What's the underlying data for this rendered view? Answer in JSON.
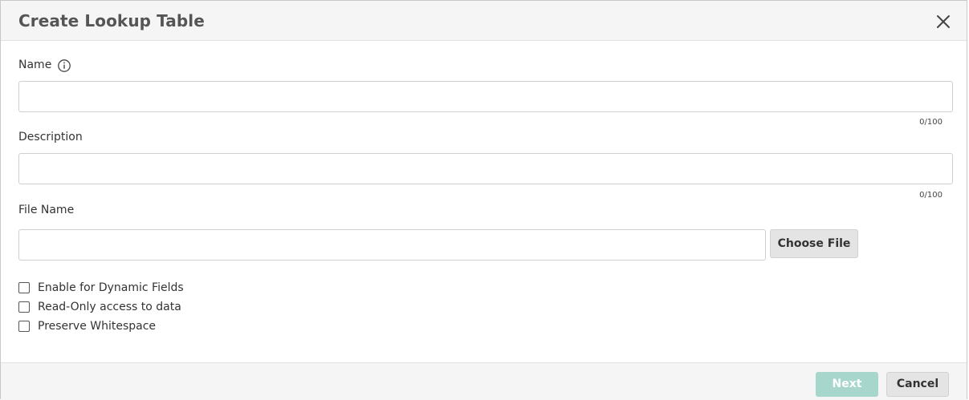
{
  "dialog": {
    "title": "Create Lookup Table",
    "close_icon": "close-icon"
  },
  "form": {
    "name": {
      "label": "Name",
      "info_icon": "info-icon",
      "value": "",
      "counter": "0/100"
    },
    "description": {
      "label": "Description",
      "value": "",
      "counter": "0/100"
    },
    "file_name": {
      "label": "File Name",
      "value": "",
      "choose_label": "Choose File"
    },
    "checkboxes": [
      {
        "label": "Enable for Dynamic Fields",
        "checked": false
      },
      {
        "label": "Read-Only access to data",
        "checked": false
      },
      {
        "label": "Preserve Whitespace",
        "checked": false
      }
    ]
  },
  "footer": {
    "next_label": "Next",
    "cancel_label": "Cancel"
  },
  "colors": {
    "next_disabled": "#a7d6cd",
    "header_bg": "#f5f5f5"
  }
}
